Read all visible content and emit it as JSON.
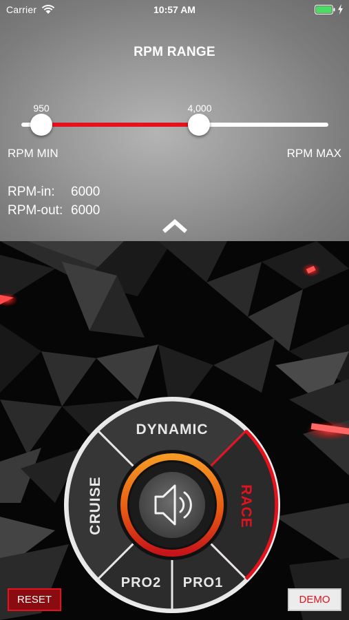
{
  "status_bar": {
    "carrier": "Carrier",
    "time": "10:57 AM"
  },
  "rpm": {
    "title": "RPM RANGE",
    "slider_min_value": "950",
    "slider_max_value": "4,000",
    "min_label": "RPM MIN",
    "max_label": "RPM MAX",
    "in_label": "RPM-in:",
    "in_value": "6000",
    "out_label": "RPM-out:",
    "out_value": "6000"
  },
  "modes": {
    "dynamic": "DYNAMIC",
    "cruise": "CRUISE",
    "race": "RACE",
    "pro2": "PRO2",
    "pro1": "PRO1",
    "active": "RACE"
  },
  "buttons": {
    "reset": "RESET",
    "demo": "DEMO"
  },
  "colors": {
    "accent": "#e3121c",
    "ring_orange": "#f08a1c",
    "battery": "#4cd964"
  },
  "icons": {
    "center": "speaker-icon",
    "collapse": "chevron-up-icon",
    "wifi": "wifi-icon",
    "battery": "battery-icon",
    "charging": "charging-bolt-icon"
  }
}
